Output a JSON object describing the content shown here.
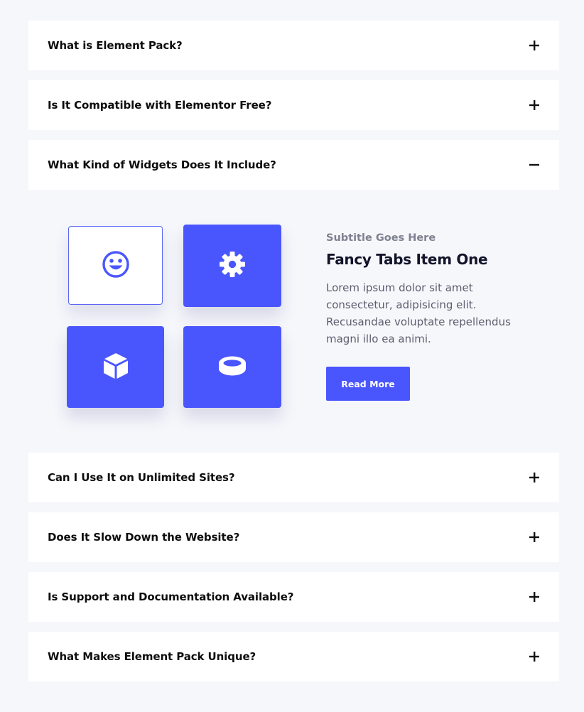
{
  "accordion": {
    "items_before": [
      {
        "question": "What is Element Pack?",
        "state": "collapsed"
      },
      {
        "question": "Is It Compatible with Elementor Free?",
        "state": "collapsed"
      },
      {
        "question": "What Kind of Widgets Does It Include?",
        "state": "expanded"
      }
    ],
    "items_after": [
      {
        "question": "Can I Use It on Unlimited Sites?",
        "state": "collapsed"
      },
      {
        "question": "Does It Slow Down the Website?",
        "state": "collapsed"
      },
      {
        "question": "Is Support and Documentation Available?",
        "state": "collapsed"
      },
      {
        "question": "What Makes Element Pack Unique?",
        "state": "collapsed"
      }
    ]
  },
  "fancy_tabs": {
    "tiles": [
      {
        "icon": "smiley-icon",
        "active": true
      },
      {
        "icon": "gear-icon",
        "active": false
      },
      {
        "icon": "cube-icon",
        "active": false
      },
      {
        "icon": "ring-icon",
        "active": false
      }
    ],
    "subtitle": "Subtitle Goes Here",
    "title": "Fancy Tabs Item One",
    "text": "Lorem ipsum dolor sit amet consectetur, adipisicing elit. Recusandae voluptate repellendus magni illo ea animi.",
    "button_label": "Read More"
  },
  "colors": {
    "accent": "#4a56fd",
    "background": "#f6f7fb",
    "card": "#ffffff",
    "heading": "#0d0d0d",
    "muted": "#7e8190"
  }
}
